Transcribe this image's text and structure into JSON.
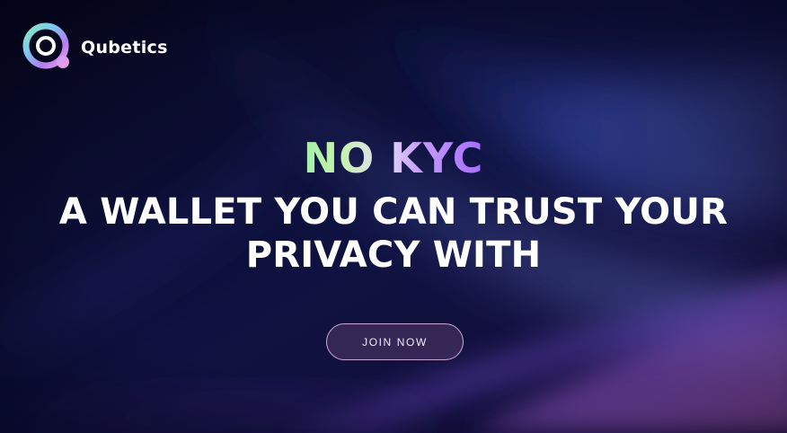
{
  "brand": {
    "name": "Qubetics",
    "logo_icon": "qubetics-ring-logo-icon"
  },
  "hero": {
    "accent_title": "NO KYC",
    "title_line_1": "A WALLET YOU CAN TRUST YOUR",
    "title_line_2": "PRIVACY WITH",
    "cta_label": "JOIN NOW"
  },
  "colors": {
    "background_dark": "#0a0a26",
    "accent_green": "#a4f0a8",
    "accent_purple": "#a56dff",
    "button_border": "#c9a6d6",
    "text_white": "#ffffff"
  }
}
